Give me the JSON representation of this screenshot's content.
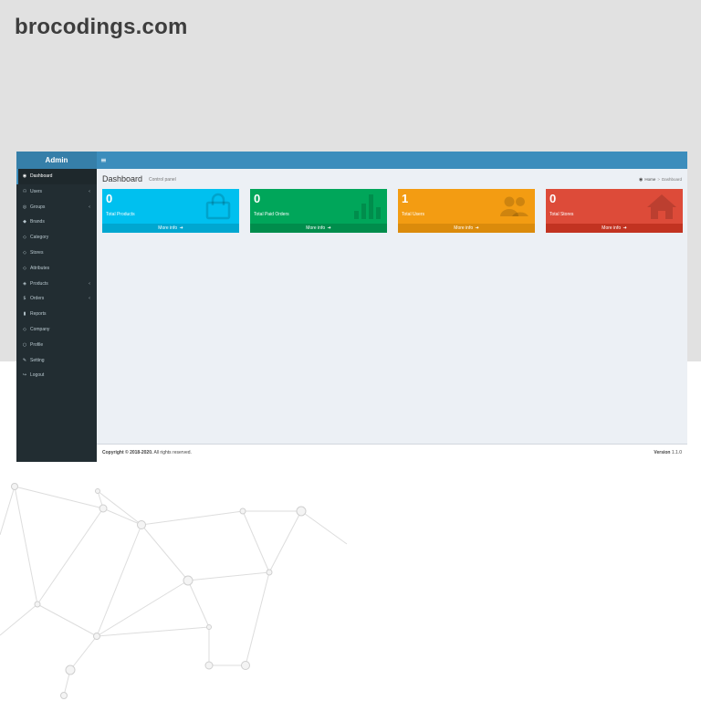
{
  "site": {
    "title": "brocodings.com"
  },
  "app": {
    "brand": "Admin",
    "toggle_icon": "menu-icon"
  },
  "sidebar": {
    "items": [
      {
        "label": "Dashboard",
        "icon": "dashboard-icon",
        "glyph": "◉",
        "active": true,
        "has_children": false
      },
      {
        "label": "Users",
        "icon": "users-icon",
        "glyph": "👥",
        "active": false,
        "has_children": true
      },
      {
        "label": "Groups",
        "icon": "groups-icon",
        "glyph": "◎",
        "active": false,
        "has_children": true
      },
      {
        "label": "Brands",
        "icon": "tag-icon",
        "glyph": "◆",
        "active": false,
        "has_children": false
      },
      {
        "label": "Category",
        "icon": "category-icon",
        "glyph": "◇",
        "active": false,
        "has_children": false
      },
      {
        "label": "Stores",
        "icon": "stores-icon",
        "glyph": "◇",
        "active": false,
        "has_children": false
      },
      {
        "label": "Attributes",
        "icon": "attributes-icon",
        "glyph": "◇",
        "active": false,
        "has_children": false
      },
      {
        "label": "Products",
        "icon": "products-icon",
        "glyph": "◈",
        "active": false,
        "has_children": true
      },
      {
        "label": "Orders",
        "icon": "dollar-icon",
        "glyph": "$",
        "active": false,
        "has_children": true
      },
      {
        "label": "Reports",
        "icon": "reports-icon",
        "glyph": "▮",
        "active": false,
        "has_children": false
      },
      {
        "label": "Company",
        "icon": "company-icon",
        "glyph": "◇",
        "active": false,
        "has_children": false
      },
      {
        "label": "Profile",
        "icon": "profile-icon",
        "glyph": "○",
        "active": false,
        "has_children": false
      },
      {
        "label": "Setting",
        "icon": "wrench-icon",
        "glyph": "✎",
        "active": false,
        "has_children": false
      },
      {
        "label": "Logout",
        "icon": "logout-icon",
        "glyph": "↪",
        "active": false,
        "has_children": false
      }
    ]
  },
  "header": {
    "title": "Dashboard",
    "subtitle": "Control panel",
    "breadcrumb": {
      "home": "Home",
      "current": "Dashboard"
    }
  },
  "stats": [
    {
      "value": "0",
      "label": "Total Products",
      "more": "More info",
      "color": "#00c0ef",
      "footer_color": "#00a7d0",
      "icon": "shopping-bag-icon"
    },
    {
      "value": "0",
      "label": "Total Paid Orders",
      "more": "More info",
      "color": "#00a65a",
      "footer_color": "#008d4c",
      "icon": "bar-chart-icon"
    },
    {
      "value": "1",
      "label": "Total Users",
      "more": "More info",
      "color": "#f39c12",
      "footer_color": "#db8b0b",
      "icon": "users-icon"
    },
    {
      "value": "0",
      "label": "Total Stores",
      "more": "More info",
      "color": "#dd4b39",
      "footer_color": "#c23321",
      "icon": "home-icon"
    }
  ],
  "footer": {
    "copyright_bold": "Copyright © 2018-2020.",
    "copyright_rest": " All rights reserved.",
    "version_label": "Version",
    "version_value": "1.1.0"
  }
}
